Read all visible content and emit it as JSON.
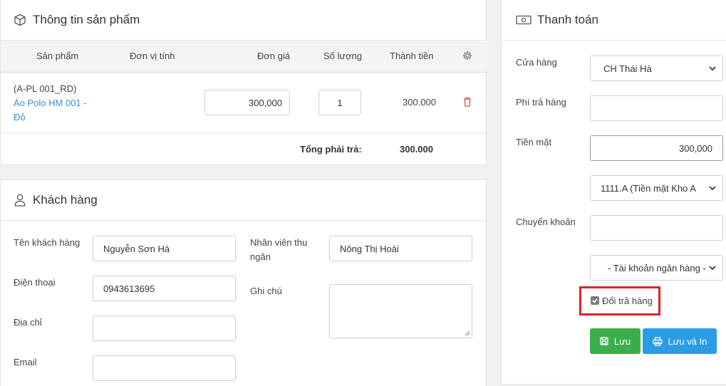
{
  "product": {
    "title": "Thông tin sản phẩm",
    "columns": {
      "product": "Sản phẩm",
      "unit": "Đơn vị tính",
      "price": "Đơn giá",
      "qty": "Số lượng",
      "total": "Thành tiền"
    },
    "row": {
      "code": "(A-PL 001_RD)",
      "name_line1": "Áo Polo HM 001 -",
      "name_line2": "Đỏ",
      "price": "300,000",
      "qty": "1",
      "total": "300.000"
    },
    "sum_label": "Tổng phải trả:",
    "sum_value": "300.000"
  },
  "customer": {
    "title": "Khách hàng",
    "name_label": "Tên khách hàng",
    "name_value": "Nguyễn Sơn Hà",
    "phone_label": "Điện thoại",
    "phone_value": "0943613695",
    "address_label": "Địa chỉ",
    "address_value": "",
    "email_label": "Email",
    "email_value": "",
    "cashier_label_line1": "Nhân viên thu",
    "cashier_label_line2": "ngân",
    "cashier_value": "Nông Thị Hoài",
    "note_label": "Ghi chú",
    "note_value": ""
  },
  "payment": {
    "title": "Thanh toán",
    "store_label": "Cửa hàng",
    "store_value": "CH Thái Hà",
    "return_fee_label": "Phí trả hàng",
    "return_fee_value": "",
    "cash_label": "Tiền mặt",
    "cash_value": "300,000",
    "cash_account_value": "1111.A (Tiền mặt Kho A",
    "transfer_label": "Chuyển khoản",
    "transfer_value": "",
    "bank_value": "- Tài khoản ngân hàng -",
    "exchange_label": "Đổi trả hàng",
    "exchange_checked": true,
    "save_label": "Lưu",
    "save_print_label": "Lưu và In"
  },
  "colors": {
    "green": "#3cad4b",
    "blue": "#2c9be6",
    "delete_red": "#e8494f",
    "highlight_red": "#d9252b"
  },
  "icons": [
    "box-icon",
    "trash-icon",
    "gear-icon",
    "user-icon",
    "cash-icon",
    "save-icon",
    "print-icon",
    "chevron-down-icon",
    "checkbox-checked-icon"
  ]
}
